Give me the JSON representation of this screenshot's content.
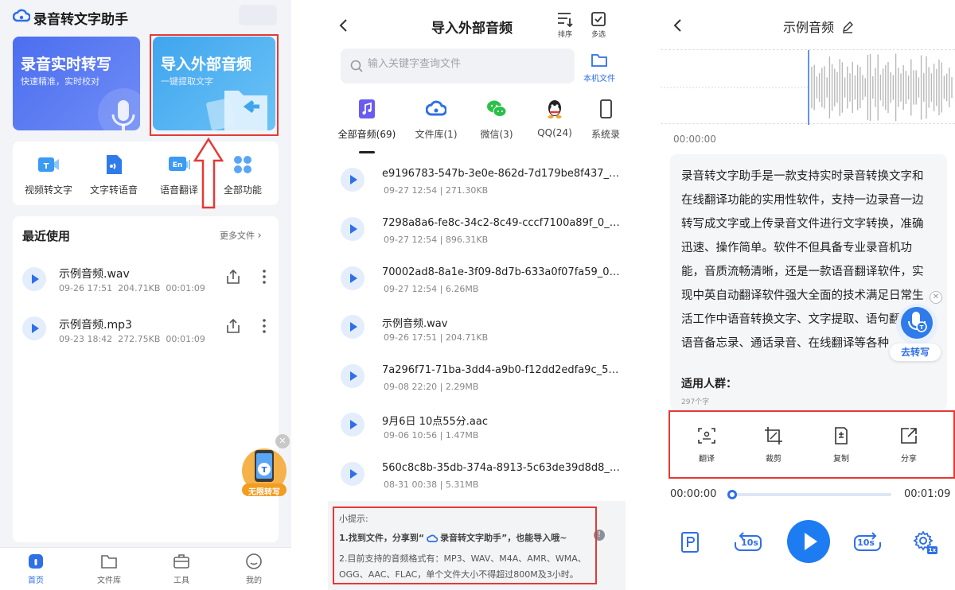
{
  "panel1": {
    "app_title": "录音转文字助手",
    "card_realtime": {
      "title": "录音实时转写",
      "subtitle": "快速精准，实时校对"
    },
    "card_import": {
      "title": "导入外部音频",
      "subtitle": "一键提取文字"
    },
    "tools": [
      {
        "label": "视频转文字",
        "icon": "video-to-text-icon"
      },
      {
        "label": "文字转语音",
        "icon": "text-to-speech-icon"
      },
      {
        "label": "语音翻译",
        "icon": "voice-translate-icon"
      },
      {
        "label": "全部功能",
        "icon": "all-functions-icon"
      }
    ],
    "recent": {
      "title": "最近使用",
      "more_label": "更多文件",
      "items": [
        {
          "name": "示例音频.wav",
          "date": "09-26 17:51",
          "size": "204.71KB",
          "duration": "00:01:09"
        },
        {
          "name": "示例音频.mp3",
          "date": "09-23 18:42",
          "size": "272.75KB",
          "duration": "00:01:09"
        }
      ]
    },
    "badge_label": "无限转写",
    "nav": [
      {
        "label": "首页",
        "icon": "home-icon"
      },
      {
        "label": "文件库",
        "icon": "folder-icon"
      },
      {
        "label": "工具",
        "icon": "toolbox-icon"
      },
      {
        "label": "我的",
        "icon": "profile-icon"
      }
    ],
    "colors": {
      "accent": "#2f6fe8",
      "highlight": "#e53935"
    }
  },
  "panel2": {
    "title": "导入外部音频",
    "sort_label": "排序",
    "multi_label": "多选",
    "search_placeholder": "输入关键字查询文件",
    "local_files_label": "本机文件",
    "tabs": [
      {
        "label": "全部音频(69)",
        "icon": "music-note-icon"
      },
      {
        "label": "文件库(1)",
        "icon": "cloud-icon"
      },
      {
        "label": "微信(3)",
        "icon": "wechat-icon"
      },
      {
        "label": "QQ(24)",
        "icon": "qq-icon"
      },
      {
        "label": "系统录",
        "icon": "phone-icon"
      }
    ],
    "files": [
      {
        "name": "e9196783-547b-3e0e-862d-7d179be8f437_0_...",
        "date": "09-27 12:54",
        "size": "271.30KB"
      },
      {
        "name": "7298a8a6-fe8c-34c2-8c49-cccf7100a89f_0_5...",
        "date": "09-27 12:54",
        "size": "896.31KB"
      },
      {
        "name": "70002ad8-8a1e-3f09-8d7b-633a0f07fa59_0_1...",
        "date": "09-27 12:54",
        "size": "6.26MB"
      },
      {
        "name": "示例音频.wav",
        "date": "09-26 17:51",
        "size": "204.71KB"
      },
      {
        "name": "7a296f71-71ba-3dd4-a9b0-f12dd2edfa9c_58_...",
        "date": "09-08 22:20",
        "size": "2.29MB"
      },
      {
        "name": "9月6日 10点55分.aac",
        "date": "09-06 10:56",
        "size": "1.47MB"
      },
      {
        "name": "560c8c8b-35db-374a-8913-5c63de39d8d8_0_...",
        "date": "08-31 00:38",
        "size": "5.31MB"
      }
    ],
    "tip": {
      "heading": "小提示:",
      "line1_pre": "1.找到文件，分享到“",
      "line1_app": "录音转文字助手",
      "line1_post": "”，也能导入哦~",
      "line2": "2.目前支持的音频格式有：MP3、WAV、M4A、AMR、WMA、",
      "line3": "OGG、AAC、FLAC，单个文件大小不得超过800M及3小时。"
    }
  },
  "panel3": {
    "title": "示例音频",
    "time_top": "00:00:00",
    "transcript_lines": [
      "录音转文字助手是一款支持实时录音转换文字和",
      "在线翻译功能的实用性软件，支持一边录音一边",
      "转写成文字或上传录音文件进行文字转换，准确",
      "迅速、操作简单。软件不但具备专业录音机功",
      "能，音质流畅清晰，还是一款语音翻译软件，实",
      "现中英自动翻译软件强大全面的技术满足日常生",
      "活工作中语音转换文字、文字提取、语句翻",
      "语音备忘录、通话录音、在线翻译等各种"
    ],
    "apply_heading": "适用人群：",
    "char_count": "297个字",
    "go_transcribe_label": "去转写",
    "actions": [
      {
        "label": "翻译",
        "icon": "translate-scan-icon"
      },
      {
        "label": "裁剪",
        "icon": "crop-icon"
      },
      {
        "label": "复制",
        "icon": "copy-doc-icon"
      },
      {
        "label": "分享",
        "icon": "share-icon"
      }
    ],
    "time_start": "00:00:00",
    "time_end": "00:01:09",
    "progress": 0.0,
    "rewind_label": "10s",
    "forward_label": "10s",
    "speed_label": "1x"
  }
}
